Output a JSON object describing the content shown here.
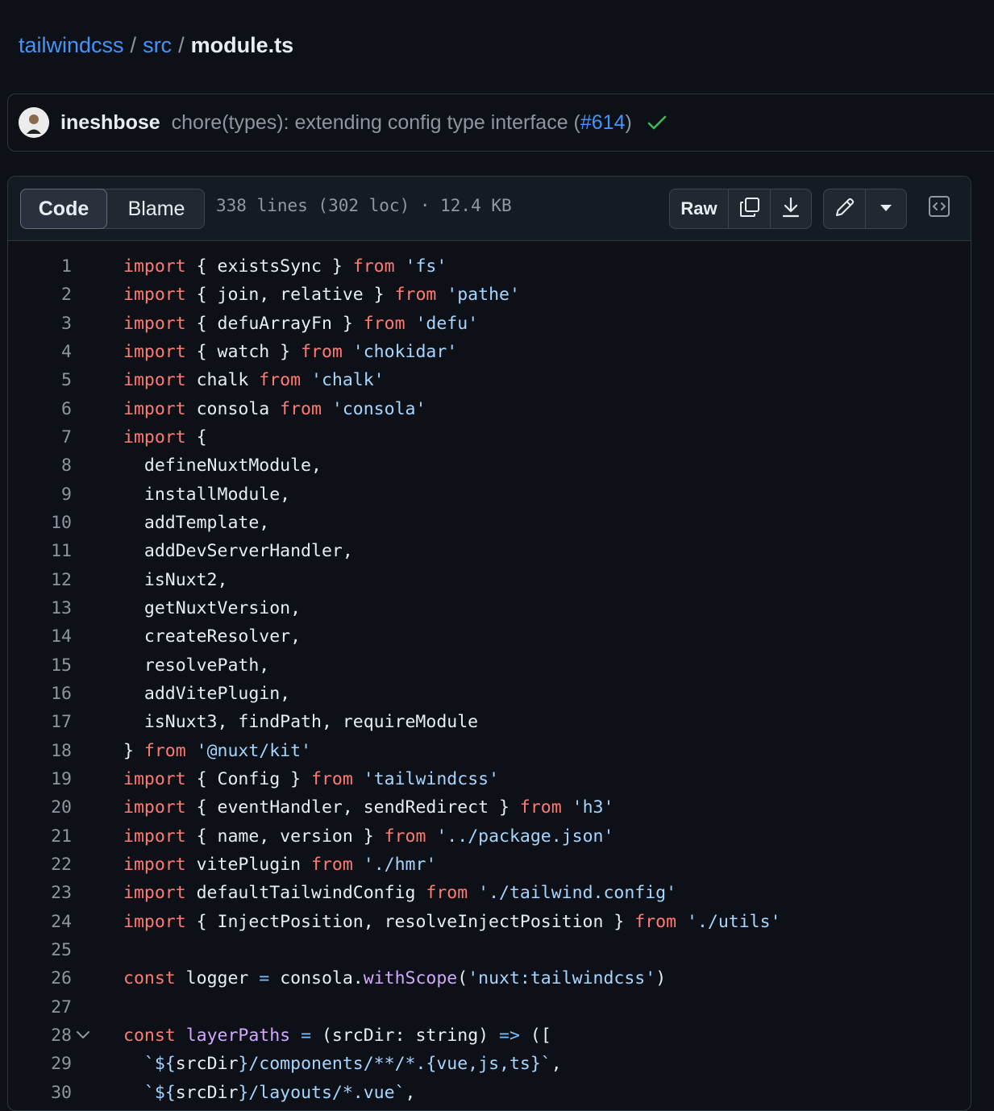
{
  "breadcrumb": {
    "repo": "tailwindcss",
    "folder": "src",
    "separator": "/",
    "file": "module.ts"
  },
  "commit": {
    "author": "ineshbose",
    "message_prefix": "chore(types): extending config type interface (",
    "pr": "#614",
    "message_suffix": ")",
    "status_icon": "check-icon",
    "status_color": "#3fb950"
  },
  "file_header": {
    "tabs": [
      {
        "label": "Code",
        "active": true
      },
      {
        "label": "Blame",
        "active": false
      }
    ],
    "info": "338 lines (302 loc) · 12.4 KB",
    "raw_label": "Raw",
    "icons": [
      "copy-icon",
      "download-icon",
      "pencil-icon",
      "triangle-down-icon",
      "code-square-icon"
    ]
  },
  "code": {
    "colors": {
      "keyword": "#ff7b72",
      "string": "#a5d6ff",
      "function": "#d2a8ff",
      "operator": "#79c0ff",
      "text": "#e6edf3"
    },
    "lines": [
      {
        "n": "1",
        "tokens": [
          [
            "kw",
            "import"
          ],
          [
            "t",
            " { existsSync } "
          ],
          [
            "kw",
            "from"
          ],
          [
            "t",
            " "
          ],
          [
            "str",
            "'fs'"
          ]
        ]
      },
      {
        "n": "2",
        "tokens": [
          [
            "kw",
            "import"
          ],
          [
            "t",
            " { join, relative } "
          ],
          [
            "kw",
            "from"
          ],
          [
            "t",
            " "
          ],
          [
            "str",
            "'pathe'"
          ]
        ]
      },
      {
        "n": "3",
        "tokens": [
          [
            "kw",
            "import"
          ],
          [
            "t",
            " { defuArrayFn } "
          ],
          [
            "kw",
            "from"
          ],
          [
            "t",
            " "
          ],
          [
            "str",
            "'defu'"
          ]
        ]
      },
      {
        "n": "4",
        "tokens": [
          [
            "kw",
            "import"
          ],
          [
            "t",
            " { watch } "
          ],
          [
            "kw",
            "from"
          ],
          [
            "t",
            " "
          ],
          [
            "str",
            "'chokidar'"
          ]
        ]
      },
      {
        "n": "5",
        "tokens": [
          [
            "kw",
            "import"
          ],
          [
            "t",
            " chalk "
          ],
          [
            "kw",
            "from"
          ],
          [
            "t",
            " "
          ],
          [
            "str",
            "'chalk'"
          ]
        ]
      },
      {
        "n": "6",
        "tokens": [
          [
            "kw",
            "import"
          ],
          [
            "t",
            " consola "
          ],
          [
            "kw",
            "from"
          ],
          [
            "t",
            " "
          ],
          [
            "str",
            "'consola'"
          ]
        ]
      },
      {
        "n": "7",
        "tokens": [
          [
            "kw",
            "import"
          ],
          [
            "t",
            " {"
          ]
        ]
      },
      {
        "n": "8",
        "tokens": [
          [
            "t",
            "  defineNuxtModule,"
          ]
        ]
      },
      {
        "n": "9",
        "tokens": [
          [
            "t",
            "  installModule,"
          ]
        ]
      },
      {
        "n": "10",
        "tokens": [
          [
            "t",
            "  addTemplate,"
          ]
        ]
      },
      {
        "n": "11",
        "tokens": [
          [
            "t",
            "  addDevServerHandler,"
          ]
        ]
      },
      {
        "n": "12",
        "tokens": [
          [
            "t",
            "  isNuxt2,"
          ]
        ]
      },
      {
        "n": "13",
        "tokens": [
          [
            "t",
            "  getNuxtVersion,"
          ]
        ]
      },
      {
        "n": "14",
        "tokens": [
          [
            "t",
            "  createResolver,"
          ]
        ]
      },
      {
        "n": "15",
        "tokens": [
          [
            "t",
            "  resolvePath,"
          ]
        ]
      },
      {
        "n": "16",
        "tokens": [
          [
            "t",
            "  addVitePlugin,"
          ]
        ]
      },
      {
        "n": "17",
        "tokens": [
          [
            "t",
            "  isNuxt3, findPath, requireModule"
          ]
        ]
      },
      {
        "n": "18",
        "tokens": [
          [
            "t",
            "} "
          ],
          [
            "kw",
            "from"
          ],
          [
            "t",
            " "
          ],
          [
            "str",
            "'@nuxt/kit'"
          ]
        ]
      },
      {
        "n": "19",
        "tokens": [
          [
            "kw",
            "import"
          ],
          [
            "t",
            " { Config } "
          ],
          [
            "kw",
            "from"
          ],
          [
            "t",
            " "
          ],
          [
            "str",
            "'tailwindcss'"
          ]
        ]
      },
      {
        "n": "20",
        "tokens": [
          [
            "kw",
            "import"
          ],
          [
            "t",
            " { eventHandler, sendRedirect } "
          ],
          [
            "kw",
            "from"
          ],
          [
            "t",
            " "
          ],
          [
            "str",
            "'h3'"
          ]
        ]
      },
      {
        "n": "21",
        "tokens": [
          [
            "kw",
            "import"
          ],
          [
            "t",
            " { name, version } "
          ],
          [
            "kw",
            "from"
          ],
          [
            "t",
            " "
          ],
          [
            "str",
            "'../package.json'"
          ]
        ]
      },
      {
        "n": "22",
        "tokens": [
          [
            "kw",
            "import"
          ],
          [
            "t",
            " vitePlugin "
          ],
          [
            "kw",
            "from"
          ],
          [
            "t",
            " "
          ],
          [
            "str",
            "'./hmr'"
          ]
        ]
      },
      {
        "n": "23",
        "tokens": [
          [
            "kw",
            "import"
          ],
          [
            "t",
            " defaultTailwindConfig "
          ],
          [
            "kw",
            "from"
          ],
          [
            "t",
            " "
          ],
          [
            "str",
            "'./tailwind.config'"
          ]
        ]
      },
      {
        "n": "24",
        "tokens": [
          [
            "kw",
            "import"
          ],
          [
            "t",
            " { InjectPosition, resolveInjectPosition } "
          ],
          [
            "kw",
            "from"
          ],
          [
            "t",
            " "
          ],
          [
            "str",
            "'./utils'"
          ]
        ]
      },
      {
        "n": "25",
        "tokens": []
      },
      {
        "n": "26",
        "tokens": [
          [
            "kw",
            "const"
          ],
          [
            "t",
            " logger "
          ],
          [
            "op",
            "="
          ],
          [
            "t",
            " consola."
          ],
          [
            "fn",
            "withScope"
          ],
          [
            "t",
            "("
          ],
          [
            "str",
            "'nuxt:tailwindcss'"
          ],
          [
            "t",
            ")"
          ]
        ]
      },
      {
        "n": "27",
        "tokens": []
      },
      {
        "n": "28",
        "fold": true,
        "tokens": [
          [
            "kw",
            "const"
          ],
          [
            "t",
            " "
          ],
          [
            "fn",
            "layerPaths"
          ],
          [
            "t",
            " "
          ],
          [
            "op",
            "="
          ],
          [
            "t",
            " (srcDir: string) "
          ],
          [
            "op",
            "=>"
          ],
          [
            "t",
            " (["
          ]
        ]
      },
      {
        "n": "29",
        "tokens": [
          [
            "t",
            "  "
          ],
          [
            "str",
            "`${"
          ],
          [
            "t",
            "srcDir"
          ],
          [
            "str",
            "}/components/**/*.{vue,js,ts}`"
          ],
          [
            "t",
            ","
          ]
        ]
      },
      {
        "n": "30",
        "tokens": [
          [
            "t",
            "  "
          ],
          [
            "str",
            "`${"
          ],
          [
            "t",
            "srcDir"
          ],
          [
            "str",
            "}/layouts/*.vue`"
          ],
          [
            "t",
            ","
          ]
        ]
      }
    ]
  }
}
